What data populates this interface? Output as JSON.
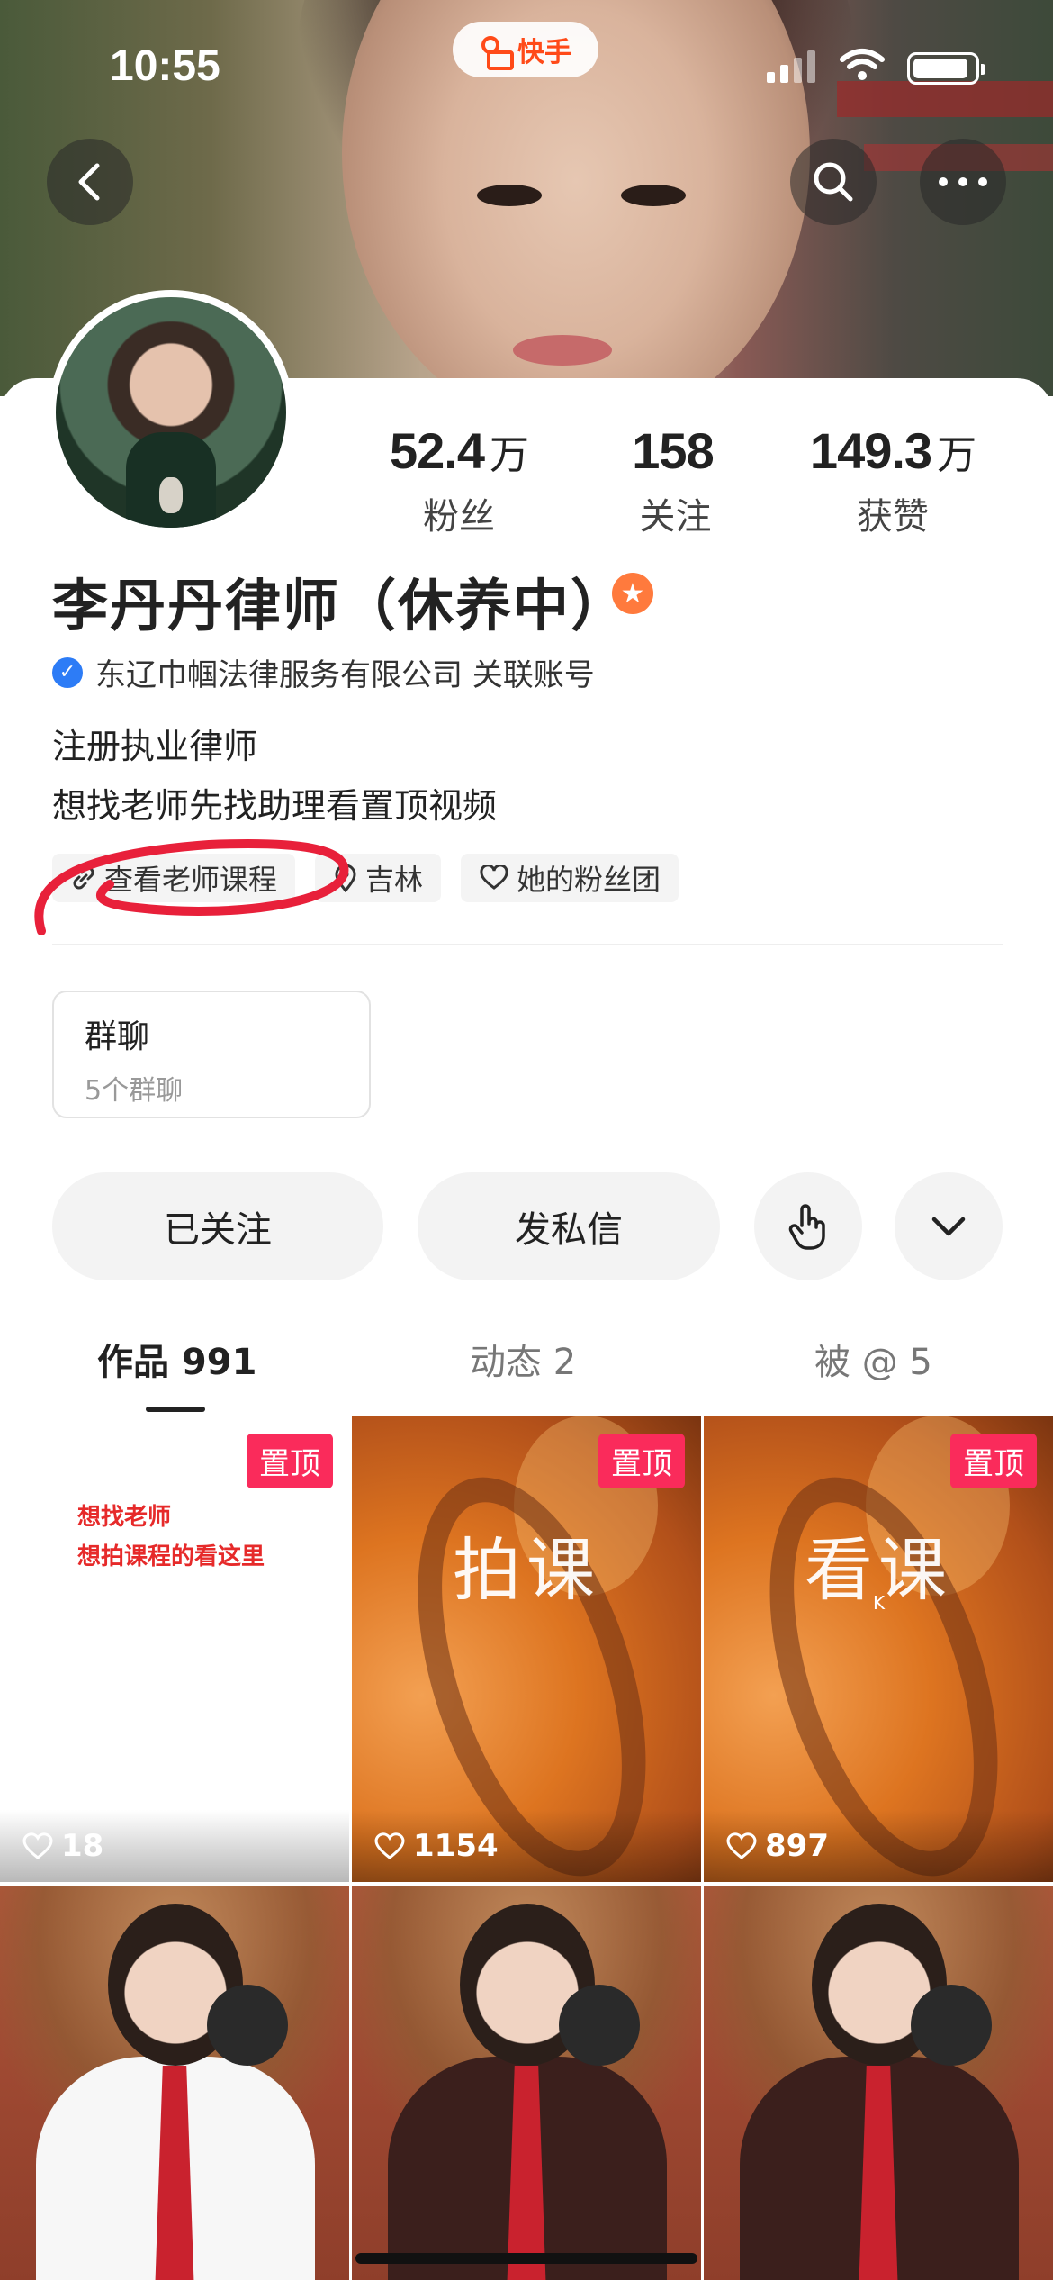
{
  "status_bar": {
    "time": "10:55",
    "app_name": "快手"
  },
  "header": {
    "back_icon": "chevron-left-icon",
    "search_icon": "search-icon",
    "more_icon": "more-dots-icon"
  },
  "profile": {
    "name": "李丹丹律师（休养中）",
    "badge_icon": "star-icon",
    "verified_org": "东辽巾帼法律服务有限公司 关联账号",
    "bio_lines": [
      "注册执业律师",
      "想找老师先找助理看置顶视频"
    ],
    "stats": [
      {
        "value": "52.4",
        "unit": "万",
        "label": "粉丝"
      },
      {
        "value": "158",
        "unit": "",
        "label": "关注"
      },
      {
        "value": "149.3",
        "unit": "万",
        "label": "获赞"
      }
    ],
    "tags": [
      {
        "icon": "link-icon",
        "label": "查看老师课程"
      },
      {
        "icon": "location-icon",
        "label": "吉林"
      },
      {
        "icon": "heart-outline-icon",
        "label": "她的粉丝团"
      }
    ]
  },
  "group_chat": {
    "title": "群聊",
    "subtitle": "5个群聊"
  },
  "actions": {
    "follow_label": "已关注",
    "message_label": "发私信",
    "gesture_icon": "hand-pointer-icon",
    "expand_icon": "chevron-down-icon"
  },
  "tabs": [
    {
      "label": "作品 991",
      "active": true
    },
    {
      "label": "动态 2",
      "active": false
    },
    {
      "label": "被 @ 5",
      "active": false
    }
  ],
  "grid": {
    "pinned_label": "置顶",
    "tiles": [
      {
        "type": "text",
        "lines": [
          "想找老师",
          "想拍课程的看这里"
        ],
        "likes": "18",
        "pinned": true
      },
      {
        "type": "title",
        "title": "拍课",
        "likes": "1154",
        "pinned": true
      },
      {
        "type": "title",
        "title": "看课",
        "sub": "K",
        "likes": "897",
        "pinned": true
      },
      {
        "type": "person"
      },
      {
        "type": "person"
      },
      {
        "type": "person"
      }
    ]
  },
  "colors": {
    "accent": "#ff4a18",
    "pin_red": "#fa2b5b",
    "verify_blue": "#2d7cf6",
    "mark_red": "#e8203a"
  }
}
